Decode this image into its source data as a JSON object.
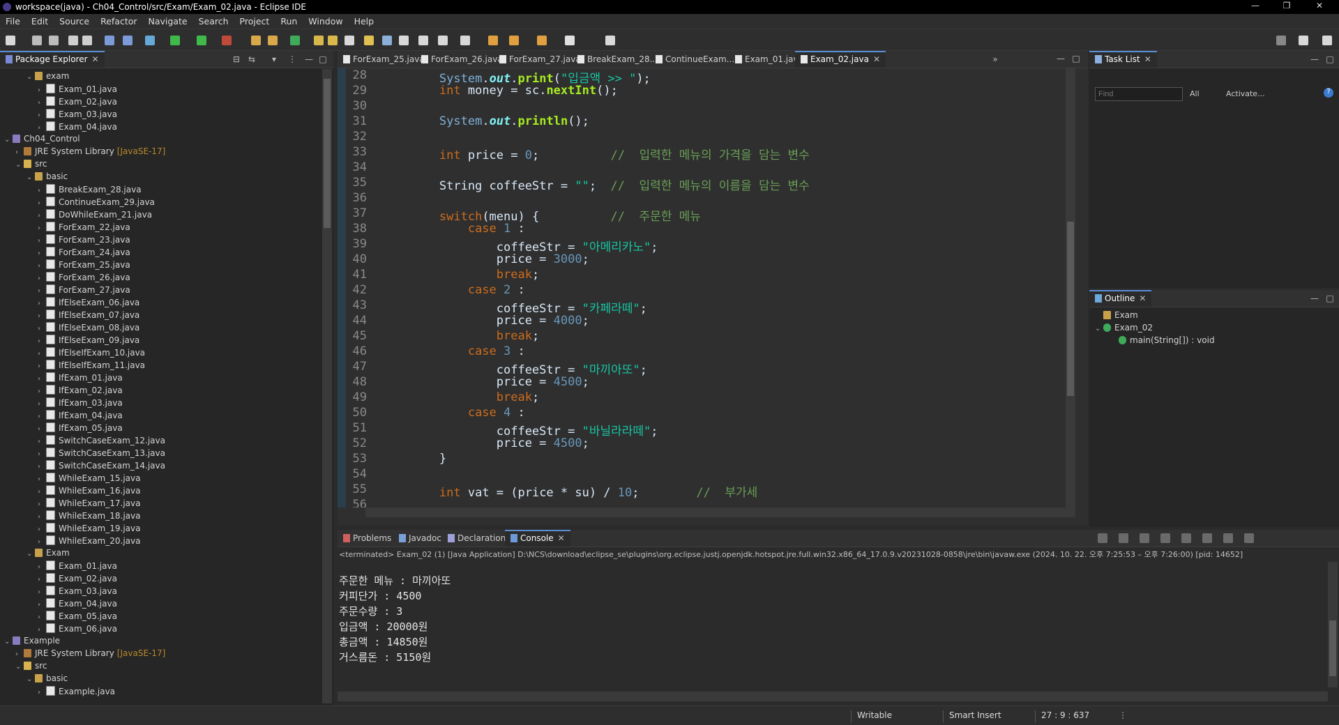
{
  "window": {
    "title": "workspace(java) - Ch04_Control/src/Exam/Exam_02.java - Eclipse IDE",
    "minimize": "—",
    "restore": "❐",
    "close": "✕"
  },
  "menu": [
    "File",
    "Edit",
    "Source",
    "Refactor",
    "Navigate",
    "Search",
    "Project",
    "Run",
    "Window",
    "Help"
  ],
  "package_explorer": {
    "title": "Package Explorer",
    "rows": [
      {
        "depth": 2,
        "arrow": "⌄",
        "icon": "pkg",
        "label": "exam"
      },
      {
        "depth": 3,
        "arrow": "›",
        "icon": "java",
        "label": "Exam_01.java"
      },
      {
        "depth": 3,
        "arrow": "›",
        "icon": "java",
        "label": "Exam_02.java"
      },
      {
        "depth": 3,
        "arrow": "›",
        "icon": "java",
        "label": "Exam_03.java"
      },
      {
        "depth": 3,
        "arrow": "›",
        "icon": "java",
        "label": "Exam_04.java"
      },
      {
        "depth": 0,
        "arrow": "⌄",
        "icon": "proj",
        "label": "Ch04_Control"
      },
      {
        "depth": 1,
        "arrow": "›",
        "icon": "lib",
        "label": "JRE System Library",
        "extra": "[JavaSE-17]"
      },
      {
        "depth": 1,
        "arrow": "⌄",
        "icon": "src",
        "label": "src"
      },
      {
        "depth": 2,
        "arrow": "⌄",
        "icon": "pkg",
        "label": "basic"
      },
      {
        "depth": 3,
        "arrow": "›",
        "icon": "java",
        "label": "BreakExam_28.java"
      },
      {
        "depth": 3,
        "arrow": "›",
        "icon": "java",
        "label": "ContinueExam_29.java"
      },
      {
        "depth": 3,
        "arrow": "›",
        "icon": "java",
        "label": "DoWhileExam_21.java"
      },
      {
        "depth": 3,
        "arrow": "›",
        "icon": "java",
        "label": "ForExam_22.java"
      },
      {
        "depth": 3,
        "arrow": "›",
        "icon": "java",
        "label": "ForExam_23.java"
      },
      {
        "depth": 3,
        "arrow": "›",
        "icon": "java",
        "label": "ForExam_24.java"
      },
      {
        "depth": 3,
        "arrow": "›",
        "icon": "java",
        "label": "ForExam_25.java"
      },
      {
        "depth": 3,
        "arrow": "›",
        "icon": "java",
        "label": "ForExam_26.java"
      },
      {
        "depth": 3,
        "arrow": "›",
        "icon": "java",
        "label": "ForExam_27.java"
      },
      {
        "depth": 3,
        "arrow": "›",
        "icon": "java",
        "label": "IfElseExam_06.java"
      },
      {
        "depth": 3,
        "arrow": "›",
        "icon": "java",
        "label": "IfElseExam_07.java"
      },
      {
        "depth": 3,
        "arrow": "›",
        "icon": "java",
        "label": "IfElseExam_08.java"
      },
      {
        "depth": 3,
        "arrow": "›",
        "icon": "java",
        "label": "IfElseExam_09.java"
      },
      {
        "depth": 3,
        "arrow": "›",
        "icon": "java",
        "label": "IfElseIfExam_10.java"
      },
      {
        "depth": 3,
        "arrow": "›",
        "icon": "java",
        "label": "IfElseIfExam_11.java"
      },
      {
        "depth": 3,
        "arrow": "›",
        "icon": "java",
        "label": "IfExam_01.java"
      },
      {
        "depth": 3,
        "arrow": "›",
        "icon": "java",
        "label": "IfExam_02.java"
      },
      {
        "depth": 3,
        "arrow": "›",
        "icon": "java",
        "label": "IfExam_03.java"
      },
      {
        "depth": 3,
        "arrow": "›",
        "icon": "java",
        "label": "IfExam_04.java"
      },
      {
        "depth": 3,
        "arrow": "›",
        "icon": "java",
        "label": "IfExam_05.java"
      },
      {
        "depth": 3,
        "arrow": "›",
        "icon": "java",
        "label": "SwitchCaseExam_12.java"
      },
      {
        "depth": 3,
        "arrow": "›",
        "icon": "java",
        "label": "SwitchCaseExam_13.java"
      },
      {
        "depth": 3,
        "arrow": "›",
        "icon": "java",
        "label": "SwitchCaseExam_14.java"
      },
      {
        "depth": 3,
        "arrow": "›",
        "icon": "java",
        "label": "WhileExam_15.java"
      },
      {
        "depth": 3,
        "arrow": "›",
        "icon": "java",
        "label": "WhileExam_16.java"
      },
      {
        "depth": 3,
        "arrow": "›",
        "icon": "java",
        "label": "WhileExam_17.java"
      },
      {
        "depth": 3,
        "arrow": "›",
        "icon": "java",
        "label": "WhileExam_18.java"
      },
      {
        "depth": 3,
        "arrow": "›",
        "icon": "java",
        "label": "WhileExam_19.java"
      },
      {
        "depth": 3,
        "arrow": "›",
        "icon": "java",
        "label": "WhileExam_20.java"
      },
      {
        "depth": 2,
        "arrow": "⌄",
        "icon": "pkg",
        "label": "Exam"
      },
      {
        "depth": 3,
        "arrow": "›",
        "icon": "java",
        "label": "Exam_01.java"
      },
      {
        "depth": 3,
        "arrow": "›",
        "icon": "java",
        "label": "Exam_02.java"
      },
      {
        "depth": 3,
        "arrow": "›",
        "icon": "java",
        "label": "Exam_03.java"
      },
      {
        "depth": 3,
        "arrow": "›",
        "icon": "java",
        "label": "Exam_04.java"
      },
      {
        "depth": 3,
        "arrow": "›",
        "icon": "java",
        "label": "Exam_05.java"
      },
      {
        "depth": 3,
        "arrow": "›",
        "icon": "java",
        "label": "Exam_06.java"
      },
      {
        "depth": 0,
        "arrow": "⌄",
        "icon": "proj",
        "label": "Example"
      },
      {
        "depth": 1,
        "arrow": "›",
        "icon": "lib",
        "label": "JRE System Library",
        "extra": "[JavaSE-17]"
      },
      {
        "depth": 1,
        "arrow": "⌄",
        "icon": "src",
        "label": "src"
      },
      {
        "depth": 2,
        "arrow": "⌄",
        "icon": "pkg",
        "label": "basic"
      },
      {
        "depth": 3,
        "arrow": "›",
        "icon": "java",
        "label": "Example.java"
      }
    ]
  },
  "editor": {
    "tabs": [
      "ForExam_25.java",
      "ForExam_26.java",
      "ForExam_27.java",
      "BreakExam_28...",
      "ContinueExam...",
      "Exam_01.java",
      "Exam_02.java"
    ],
    "active_tab": "Exam_02.java",
    "overflow": "»",
    "lines": [
      {
        "n": "28",
        "html": "        System.<span class='f'>out</span>.print(<span class='s'>\"입금액 >> \"</span>);"
      },
      {
        "n": "29",
        "html": "        <span class='k'>int</span> money = sc.nextInt();"
      },
      {
        "n": "30",
        "html": ""
      },
      {
        "n": "31",
        "html": "        System.<span class='f'>out</span>.println();"
      },
      {
        "n": "32",
        "html": ""
      },
      {
        "n": "33",
        "html": "        <span class='k'>int</span> price = <span class='n'>0</span>;          <span class='c'>//  입력한 메뉴의 가격을 담는 변수</span>"
      },
      {
        "n": "34",
        "html": ""
      },
      {
        "n": "35",
        "html": "        String coffeeStr = <span class='s'>\"\"</span>;  <span class='c'>//  입력한 메뉴의 이름을 담는 변수</span>"
      },
      {
        "n": "36",
        "html": ""
      },
      {
        "n": "37",
        "html": "        <span class='k'>switch</span>(menu) {          <span class='c'>//  주문한 메뉴</span>"
      },
      {
        "n": "38",
        "html": "            <span class='k'>case</span> <span class='n'>1</span> :"
      },
      {
        "n": "39",
        "html": "                coffeeStr = <span class='s'>\"아메리카노\"</span>;"
      },
      {
        "n": "40",
        "html": "                price = <span class='n'>3000</span>;"
      },
      {
        "n": "41",
        "html": "                <span class='k'>break</span>;"
      },
      {
        "n": "42",
        "html": "            <span class='k'>case</span> <span class='n'>2</span> :"
      },
      {
        "n": "43",
        "html": "                coffeeStr = <span class='s'>\"카페라떼\"</span>;"
      },
      {
        "n": "44",
        "html": "                price = <span class='n'>4000</span>;"
      },
      {
        "n": "45",
        "html": "                <span class='k'>break</span>;"
      },
      {
        "n": "46",
        "html": "            <span class='k'>case</span> <span class='n'>3</span> :"
      },
      {
        "n": "47",
        "html": "                coffeeStr = <span class='s'>\"마끼아또\"</span>;"
      },
      {
        "n": "48",
        "html": "                price = <span class='n'>4500</span>;"
      },
      {
        "n": "49",
        "html": "                <span class='k'>break</span>;"
      },
      {
        "n": "50",
        "html": "            <span class='k'>case</span> <span class='n'>4</span> :"
      },
      {
        "n": "51",
        "html": "                coffeeStr = <span class='s'>\"바닐라라떼\"</span>;"
      },
      {
        "n": "52",
        "html": "                price = <span class='n'>4500</span>;"
      },
      {
        "n": "53",
        "html": "        }"
      },
      {
        "n": "54",
        "html": ""
      },
      {
        "n": "55",
        "html": "        <span class='k'>int</span> vat = (price * su) / <span class='n'>10</span>;        <span class='c'>//  부가세</span>"
      },
      {
        "n": "56",
        "html": ""
      }
    ]
  },
  "task_list": {
    "title": "Task List",
    "find_placeholder": "Find",
    "all_label": "All",
    "activate_label": "Activate..."
  },
  "outline": {
    "title": "Outline",
    "items": [
      {
        "label": "Exam",
        "depth": 0,
        "arrow": ""
      },
      {
        "label": "Exam_02",
        "depth": 0,
        "arrow": "⌄"
      },
      {
        "label": "main(String[]) : void",
        "depth": 1,
        "arrow": ""
      }
    ]
  },
  "bottom": {
    "tabs": [
      "Problems",
      "Javadoc",
      "Declaration",
      "Console"
    ],
    "active_tab": "Console",
    "terminated": "<terminated> Exam_02 (1) [Java Application] D:\\NCS\\download\\eclipse_se\\plugins\\org.eclipse.justj.openjdk.hotspot.jre.full.win32.x86_64_17.0.9.v20231028-0858\\jre\\bin\\javaw.exe  (2024. 10. 22. 오후 7:25:53 – 오후 7:26:00) [pid: 14652]",
    "output": [
      "주문한 메뉴 : 마끼아또",
      "커피단가 : 4500",
      "주문수량 : 3",
      "입금액 : 20000원",
      "총금액 : 14850원",
      "거스름돈 : 5150원"
    ]
  },
  "status": {
    "writable": "Writable",
    "insert_mode": "Smart Insert",
    "position": "27 : 9 : 637"
  }
}
